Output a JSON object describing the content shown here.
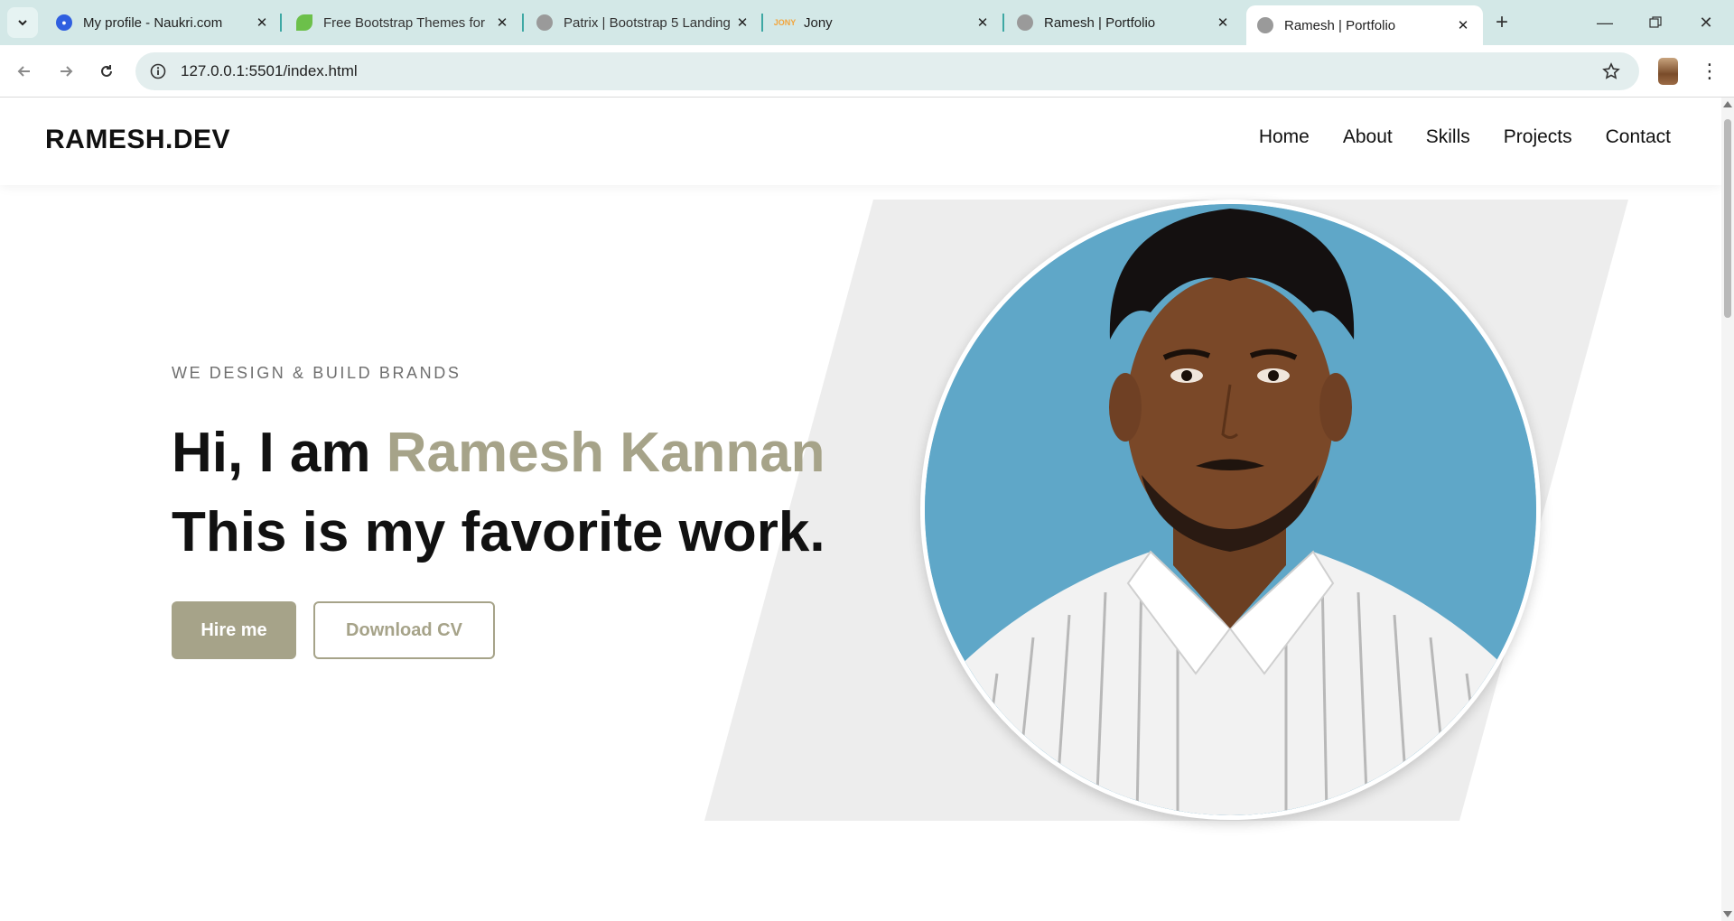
{
  "browser": {
    "tabs": [
      {
        "title": "My profile - Naukri.com",
        "favicon": "naukri-icon",
        "color": "#2f5fe0"
      },
      {
        "title": "Free Bootstrap Themes for",
        "favicon": "leaf-icon",
        "color": "#6cc04a"
      },
      {
        "title": "Patrix | Bootstrap 5 Landing",
        "favicon": "globe-icon",
        "color": "#8a8a8a"
      },
      {
        "title": "Jony",
        "favicon": "jony-icon",
        "color": "#f3a53b"
      },
      {
        "title": "Ramesh | Portfolio",
        "favicon": "globe-icon",
        "color": "#8a8a8a"
      },
      {
        "title": "Ramesh | Portfolio",
        "favicon": "globe-icon",
        "color": "#8a8a8a",
        "active": true
      }
    ],
    "url": "127.0.0.1:5501/index.html",
    "jony_fav_text": "JONY"
  },
  "site": {
    "logo": "RAMESH.DEV",
    "nav": [
      "Home",
      "About",
      "Skills",
      "Projects",
      "Contact"
    ]
  },
  "hero": {
    "eyebrow": "WE DESIGN & BUILD BRANDS",
    "line1_prefix": "Hi, I am ",
    "line1_name": "Ramesh Kannan",
    "line2": "This is my favorite work.",
    "hire_label": "Hire me",
    "cv_label": "Download CV"
  },
  "colors": {
    "accent": "#a6a389",
    "shape": "#ededed",
    "photo_bg": "#5fa7c8",
    "tabbar": "#d3e8e7"
  }
}
